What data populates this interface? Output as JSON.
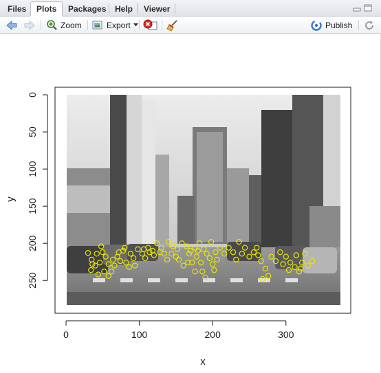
{
  "tabs": [
    {
      "label": "Files",
      "active": false
    },
    {
      "label": "Plots",
      "active": true
    },
    {
      "label": "Packages",
      "active": false
    },
    {
      "label": "Help",
      "active": false
    },
    {
      "label": "Viewer",
      "active": false
    }
  ],
  "toolbar": {
    "zoom_label": "Zoom",
    "export_label": "Export",
    "publish_label": "Publish",
    "icons": [
      "back-arrow-icon",
      "forward-arrow-icon",
      "zoom-icon",
      "export-icon",
      "remove-plot-icon",
      "clear-all-broom-icon",
      "publish-icon",
      "refresh-icon"
    ]
  },
  "plot": {
    "xlabel": "x",
    "ylabel": "y",
    "x_ticks": [
      "0",
      "100",
      "200",
      "300"
    ],
    "y_ticks": [
      "0",
      "50",
      "100",
      "150",
      "200",
      "250"
    ],
    "image": "grayscale street scene with buildings and pedestrians",
    "point_color": "#e6e600"
  },
  "chart_data": {
    "type": "scatter",
    "title": "",
    "xlabel": "x",
    "ylabel": "y",
    "xlim": [
      0,
      375
    ],
    "ylim": [
      283,
      0
    ],
    "x_tick_values": [
      0,
      100,
      200,
      300
    ],
    "y_tick_values": [
      0,
      50,
      100,
      150,
      200,
      250
    ],
    "y_reversed": true,
    "points": [
      [
        30,
        213
      ],
      [
        35,
        222
      ],
      [
        40,
        230
      ],
      [
        46,
        226
      ],
      [
        50,
        212
      ],
      [
        54,
        218
      ],
      [
        58,
        228
      ],
      [
        62,
        238
      ],
      [
        66,
        230
      ],
      [
        70,
        218
      ],
      [
        74,
        224
      ],
      [
        78,
        210
      ],
      [
        82,
        226
      ],
      [
        88,
        214
      ],
      [
        92,
        220
      ],
      [
        98,
        208
      ],
      [
        104,
        214
      ],
      [
        108,
        220
      ],
      [
        112,
        206
      ],
      [
        118,
        210
      ],
      [
        124,
        200
      ],
      [
        130,
        206
      ],
      [
        134,
        214
      ],
      [
        140,
        198
      ],
      [
        146,
        204
      ],
      [
        152,
        208
      ],
      [
        158,
        200
      ],
      [
        164,
        204
      ],
      [
        170,
        210
      ],
      [
        176,
        206
      ],
      [
        182,
        200
      ],
      [
        188,
        208
      ],
      [
        192,
        214
      ],
      [
        196,
        220
      ],
      [
        200,
        228
      ],
      [
        186,
        238
      ],
      [
        190,
        246
      ],
      [
        178,
        218
      ],
      [
        172,
        226
      ],
      [
        204,
        212
      ],
      [
        210,
        206
      ],
      [
        216,
        214
      ],
      [
        222,
        206
      ],
      [
        228,
        212
      ],
      [
        236,
        198
      ],
      [
        244,
        206
      ],
      [
        256,
        212
      ],
      [
        262,
        216
      ],
      [
        266,
        224
      ],
      [
        272,
        234
      ],
      [
        276,
        244
      ],
      [
        268,
        248
      ],
      [
        280,
        218
      ],
      [
        286,
        224
      ],
      [
        292,
        212
      ],
      [
        300,
        218
      ],
      [
        306,
        226
      ],
      [
        312,
        232
      ],
      [
        318,
        238
      ],
      [
        322,
        226
      ],
      [
        330,
        230
      ],
      [
        336,
        224
      ],
      [
        326,
        214
      ],
      [
        34,
        236
      ],
      [
        44,
        242
      ],
      [
        58,
        244
      ],
      [
        52,
        238
      ],
      [
        64,
        222
      ],
      [
        72,
        212
      ],
      [
        80,
        206
      ],
      [
        86,
        232
      ],
      [
        48,
        204
      ],
      [
        42,
        214
      ],
      [
        36,
        228
      ],
      [
        154,
        222
      ],
      [
        160,
        230
      ],
      [
        166,
        226
      ],
      [
        144,
        214
      ],
      [
        138,
        222
      ],
      [
        120,
        216
      ],
      [
        114,
        212
      ],
      [
        198,
        198
      ],
      [
        202,
        236
      ],
      [
        184,
        226
      ],
      [
        176,
        238
      ],
      [
        206,
        222
      ],
      [
        250,
        218
      ],
      [
        296,
        228
      ],
      [
        304,
        236
      ],
      [
        314,
        216
      ],
      [
        320,
        234
      ],
      [
        260,
        206
      ],
      [
        240,
        214
      ],
      [
        232,
        222
      ],
      [
        106,
        208
      ],
      [
        94,
        230
      ],
      [
        128,
        212
      ],
      [
        150,
        218
      ],
      [
        168,
        214
      ],
      [
        180,
        210
      ]
    ]
  }
}
